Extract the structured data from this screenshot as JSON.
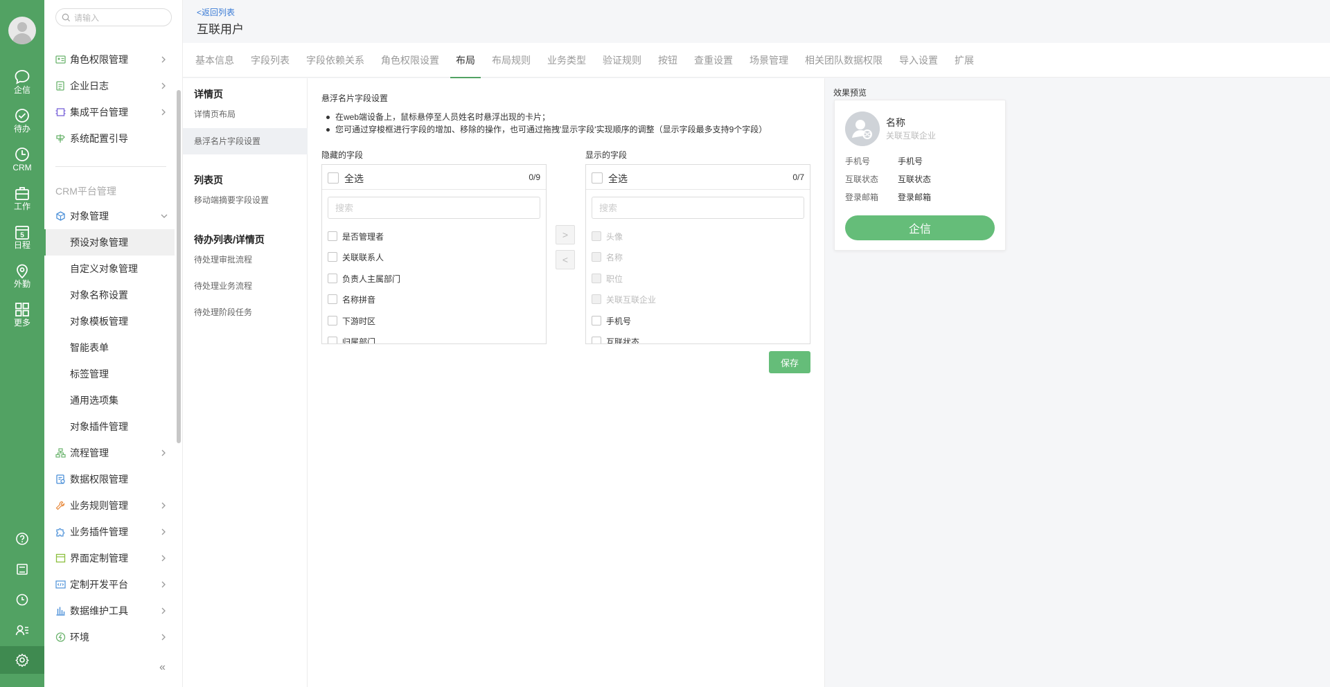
{
  "rail": {
    "items": [
      {
        "label": "企信",
        "icon": "chat-icon"
      },
      {
        "label": "待办",
        "icon": "check-circle-icon"
      },
      {
        "label": "CRM",
        "icon": "clock-icon"
      },
      {
        "label": "工作",
        "icon": "briefcase-icon"
      },
      {
        "label": "日程",
        "icon": "calendar-icon",
        "day": "5"
      },
      {
        "label": "外勤",
        "icon": "location-icon"
      },
      {
        "label": "更多",
        "icon": "grid-icon"
      }
    ],
    "bottom_icons": [
      "help-icon",
      "notebook-icon",
      "history-icon",
      "user-list-icon",
      "settings-icon"
    ]
  },
  "sidebar": {
    "search_placeholder": "请输入",
    "top_items": [
      {
        "label": "角色权限管理",
        "icon": "role-icon"
      },
      {
        "label": "企业日志",
        "icon": "log-icon"
      },
      {
        "label": "集成平台管理",
        "icon": "chip-icon"
      },
      {
        "label": "系统配置引导",
        "icon": "signpost-icon"
      }
    ],
    "group_label": "CRM平台管理",
    "object_mgmt": {
      "label": "对象管理",
      "icon": "object-icon"
    },
    "sub_items": [
      "预设对象管理",
      "自定义对象管理",
      "对象名称设置",
      "对象模板管理",
      "智能表单",
      "标签管理",
      "通用选项集",
      "对象插件管理"
    ],
    "bottom_items": [
      {
        "label": "流程管理",
        "icon": "flow-icon"
      },
      {
        "label": "数据权限管理",
        "icon": "data-permission-icon"
      },
      {
        "label": "业务规则管理",
        "icon": "wrench-icon"
      },
      {
        "label": "业务插件管理",
        "icon": "puzzle-icon"
      },
      {
        "label": "界面定制管理",
        "icon": "layout-icon"
      },
      {
        "label": "定制开发平台",
        "icon": "code-icon"
      },
      {
        "label": "数据维护工具",
        "icon": "bar-chart-icon"
      },
      {
        "label": "环境",
        "icon": "environment-icon"
      }
    ],
    "collapse_label": "«"
  },
  "header": {
    "back_link": "<返回列表",
    "title": "互联用户"
  },
  "tabs": [
    "基本信息",
    "字段列表",
    "字段依赖关系",
    "角色权限设置",
    "布局",
    "布局规则",
    "业务类型",
    "验证规则",
    "按钮",
    "查重设置",
    "场景管理",
    "相关团队数据权限",
    "导入设置",
    "扩展"
  ],
  "active_tab": "布局",
  "subnav": {
    "detail_heading": "详情页",
    "detail_items": [
      "详情页布局",
      "悬浮名片字段设置"
    ],
    "list_heading": "列表页",
    "list_items": [
      "移动端摘要字段设置"
    ],
    "todo_heading": "待办列表/详情页",
    "todo_items": [
      "待处理审批流程",
      "待处理业务流程",
      "待处理阶段任务"
    ]
  },
  "main": {
    "section_title": "悬浮名片字段设置",
    "notes": [
      "在web端设备上，鼠标悬停至人员姓名时悬浮出现的卡片；",
      "您可通过穿梭框进行字段的增加、移除的操作，也可通过拖拽'显示字段'实现顺序的调整（显示字段最多支持9个字段）"
    ],
    "hidden": {
      "label": "隐藏的字段",
      "select_all": "全选",
      "count": "0/9",
      "search_placeholder": "搜索",
      "fields": [
        "是否管理者",
        "关联联系人",
        "负责人主属部门",
        "名称拼音",
        "下游时区",
        "归属部门"
      ]
    },
    "shown": {
      "label": "显示的字段",
      "select_all": "全选",
      "count": "0/7",
      "search_placeholder": "搜索",
      "fields": [
        {
          "label": "头像",
          "disabled": true
        },
        {
          "label": "名称",
          "disabled": true
        },
        {
          "label": "职位",
          "disabled": true
        },
        {
          "label": "关联互联企业",
          "disabled": true
        },
        {
          "label": "手机号",
          "disabled": false
        },
        {
          "label": "互联状态",
          "disabled": false
        }
      ]
    },
    "move_right": ">",
    "move_left": "<",
    "save_label": "保存"
  },
  "preview": {
    "label": "效果预览",
    "card": {
      "name": "名称",
      "subtitle": "关联互联企业",
      "rows": [
        {
          "key": "手机号",
          "value": "手机号"
        },
        {
          "key": "互联状态",
          "value": "互联状态"
        },
        {
          "key": "登录邮箱",
          "value": "登录邮箱"
        }
      ],
      "button": "企信"
    }
  },
  "colors": {
    "brand_green": "#52a263",
    "button_green": "#65bd79",
    "link_blue": "#3a7bd5"
  }
}
